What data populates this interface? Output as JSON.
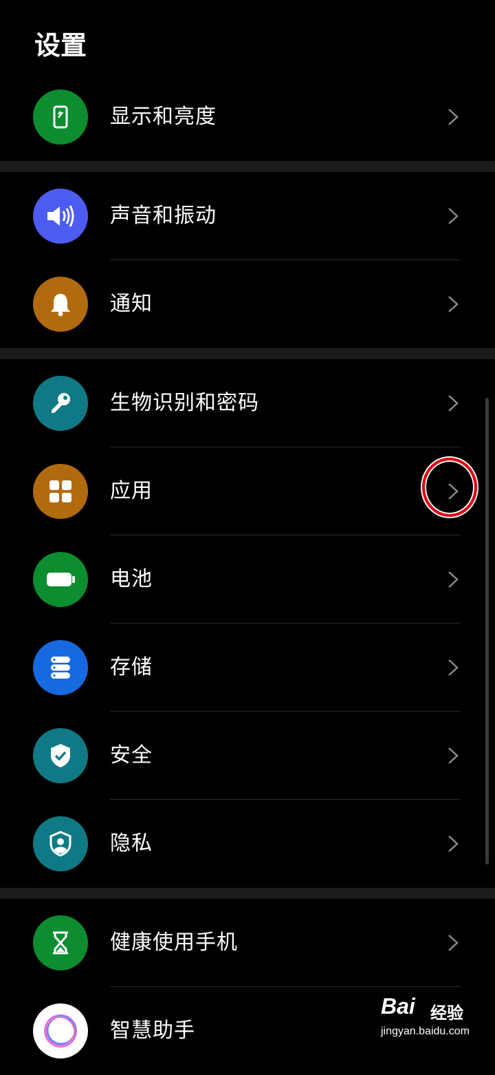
{
  "page_title": "设置",
  "items": [
    {
      "label": "显示和亮度",
      "icon": "display-brightness-icon",
      "color": "#0c8d2f"
    },
    {
      "label": "声音和振动",
      "icon": "speaker-icon",
      "color": "#4d5cf0"
    },
    {
      "label": "通知",
      "icon": "bell-icon",
      "color": "#b26a0e"
    },
    {
      "label": "生物识别和密码",
      "icon": "key-icon",
      "color": "#0f7a86"
    },
    {
      "label": "应用",
      "icon": "apps-grid-icon",
      "color": "#b26a0e"
    },
    {
      "label": "电池",
      "icon": "battery-icon",
      "color": "#0c8d2f"
    },
    {
      "label": "存储",
      "icon": "storage-icon",
      "color": "#1769e0"
    },
    {
      "label": "安全",
      "icon": "shield-check-icon",
      "color": "#0f7a86"
    },
    {
      "label": "隐私",
      "icon": "privacy-shield-icon",
      "color": "#0f7a86"
    },
    {
      "label": "健康使用手机",
      "icon": "hourglass-icon",
      "color": "#0c8d2f"
    },
    {
      "label": "智慧助手",
      "icon": "assistant-ring-icon",
      "color": "#ffffff"
    }
  ],
  "watermark": {
    "logo": "Bai",
    "text": "经验",
    "url": "jingyan.baidu.com"
  },
  "highlight_color": "#e60012"
}
